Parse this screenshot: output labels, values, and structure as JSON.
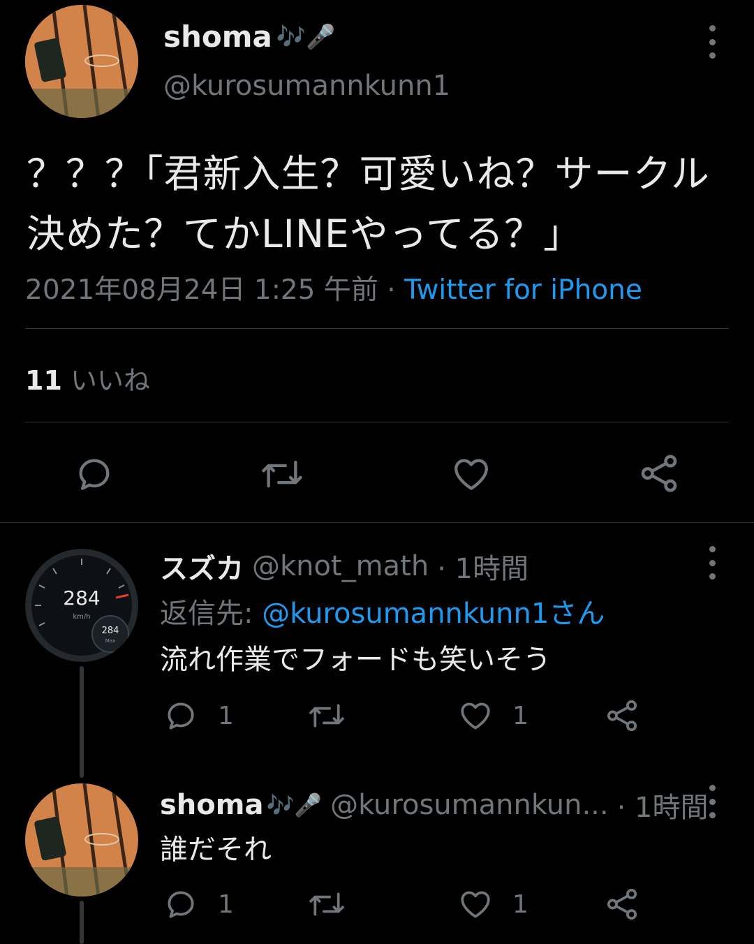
{
  "main_tweet": {
    "name": "shoma",
    "name_emoji": "🎶🎤",
    "handle": "@kurosumannkunn1",
    "text": "？？？｢君新入生？可愛いね？サークル決めた？てかLINEやってる？｣",
    "timestamp": "2021年08月24日 1:25 午前",
    "separator": "·",
    "source": "Twitter for iPhone",
    "likes_count": "11",
    "likes_label": "いいね"
  },
  "replies": [
    {
      "name": "スズカ",
      "handle": "@knot_math",
      "time": "· 1時間",
      "reply_to_label": "返信先:",
      "reply_to_handle": "@kurosumannkunn1さん",
      "text": "流れ作業でフォードも笑いそう",
      "reply_count": "1",
      "retweet_count": "",
      "like_count": "1",
      "avatar_speed": "284",
      "avatar_unit": "km/h",
      "avatar_max": "284",
      "avatar_max_label": "Max"
    },
    {
      "name": "shoma",
      "name_emoji": "🎶🎤",
      "handle": "@kurosumannkun...",
      "time": "· 1時間",
      "text": "誰だそれ",
      "reply_count": "1",
      "retweet_count": "",
      "like_count": "1"
    }
  ],
  "colors": {
    "background": "#000000",
    "text": "#e7e9ea",
    "muted": "#71767b",
    "link": "#1d9bf0",
    "divider": "#2f3336"
  },
  "icons": [
    "reply-icon",
    "retweet-icon",
    "like-icon",
    "share-icon",
    "more-icon"
  ]
}
